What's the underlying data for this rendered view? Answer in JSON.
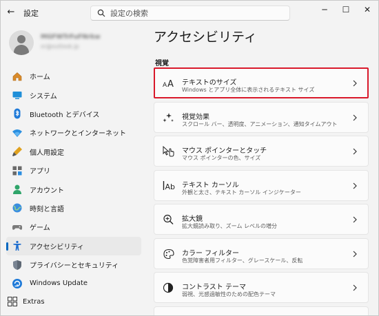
{
  "titlebar": {
    "app_title": "設定",
    "search_placeholder": "設定の検索",
    "minimize": "─",
    "maximize": "☐",
    "close": "✕"
  },
  "profile": {
    "name": "MGFWTrFuFNrkw",
    "email": "xr@outlook.jp"
  },
  "sidebar": {
    "items": [
      {
        "label": "ホーム",
        "icon": "home-icon"
      },
      {
        "label": "システム",
        "icon": "system-icon"
      },
      {
        "label": "Bluetooth とデバイス",
        "icon": "bluetooth-icon"
      },
      {
        "label": "ネットワークとインターネット",
        "icon": "wifi-icon"
      },
      {
        "label": "個人用設定",
        "icon": "personalization-icon"
      },
      {
        "label": "アプリ",
        "icon": "apps-icon"
      },
      {
        "label": "アカウント",
        "icon": "account-icon"
      },
      {
        "label": "時刻と言語",
        "icon": "time-language-icon"
      },
      {
        "label": "ゲーム",
        "icon": "gaming-icon"
      },
      {
        "label": "アクセシビリティ",
        "icon": "accessibility-icon"
      },
      {
        "label": "プライバシーとセキュリティ",
        "icon": "privacy-shield-icon"
      },
      {
        "label": "Windows Update",
        "icon": "windows-update-icon"
      }
    ],
    "active_label": "アクセシビリティ",
    "extras": "Extras"
  },
  "main": {
    "title": "アクセシビリティ",
    "section": "視覚",
    "cards": [
      {
        "title": "テキストのサイズ",
        "desc": "Windows とアプリ全体に表示されるテキスト サイズ",
        "icon": "text-size-icon"
      },
      {
        "title": "視覚効果",
        "desc": "スクロール バー、透明度、アニメーション、通知タイムアウト",
        "icon": "visual-effects-icon"
      },
      {
        "title": "マウス ポインターとタッチ",
        "desc": "マウス ポインターの色、サイズ",
        "icon": "mouse-pointer-icon"
      },
      {
        "title": "テキスト カーソル",
        "desc": "外観と太さ、テキスト カーソル インジケーター",
        "icon": "text-cursor-icon"
      },
      {
        "title": "拡大鏡",
        "desc": "拡大鏡読み取り、ズーム レベルの増分",
        "icon": "magnifier-icon"
      },
      {
        "title": "カラー フィルター",
        "desc": "色覚障害者用フィルター、グレースケール、反転",
        "icon": "color-filter-icon"
      },
      {
        "title": "コントラスト テーマ",
        "desc": "弱視、光感過敏性のための配色テーマ",
        "icon": "contrast-icon"
      }
    ]
  },
  "colors": {
    "accent": "#0067c0",
    "highlight_border": "#d9182a"
  }
}
